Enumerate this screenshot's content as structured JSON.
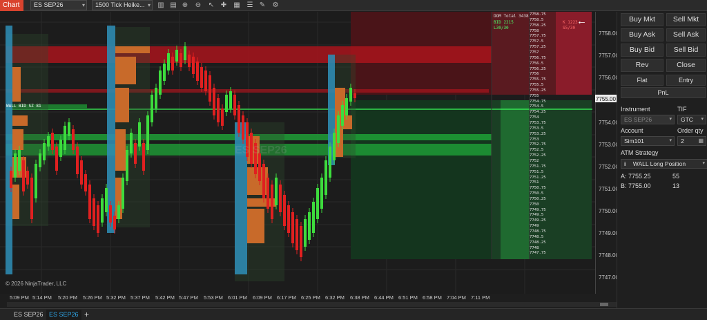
{
  "toolbar": {
    "app_tab": "Chart",
    "instrument": "ES SEP26",
    "bar_type": "1500 Tick Heike..."
  },
  "chart": {
    "watermark": "ES SEP26",
    "copyright": "© 2026 NinjaTrader, LLC",
    "wall_label": "WALL BID SZ 81",
    "last_price": "7755.00",
    "y_ticks": [
      "7758.00",
      "7757.00",
      "7756.00",
      "7755.00",
      "7754.00",
      "7753.00",
      "7752.00",
      "7751.00",
      "7750.00",
      "7749.00",
      "7748.00",
      "7747.00"
    ],
    "x_ticks": [
      "5:09 PM",
      "5:14 PM",
      "5:20 PM",
      "5:26 PM",
      "5:32 PM",
      "5:37 PM",
      "5:42 PM",
      "5:47 PM",
      "5:53 PM",
      "6:01 PM",
      "6:09 PM",
      "6:17 PM",
      "6:25 PM",
      "6:32 PM",
      "6:38 PM",
      "6:44 PM",
      "6:51 PM",
      "6:58 PM",
      "7:04 PM",
      "7:11 PM"
    ],
    "colors": {
      "up": "#3ddc3d",
      "down": "#e02020",
      "bid": "#1f7a33",
      "ask": "#8a1c22",
      "volume_blue": "#2e8fb8",
      "volume_orange": "#c86a2a"
    }
  },
  "dom": {
    "total": "DOM Total 3438",
    "bid": "BID 2215",
    "ask": "K 1223",
    "ratio_left": "L30/30",
    "ratio_right": "S5/30",
    "price_rows": [
      "7758.75",
      "7758.5",
      "7758.25",
      "7758",
      "7757.75",
      "7757.5",
      "7757.25",
      "7757",
      "7756.75",
      "7756.5",
      "7756.25",
      "7756",
      "7755.75",
      "7755.5",
      "7755.25",
      "7755",
      "7754.75",
      "7754.5",
      "7754.25",
      "7754",
      "7753.75",
      "7753.5",
      "7753.25",
      "7753",
      "7752.75",
      "7752.5",
      "7752.25",
      "7752",
      "7751.75",
      "7751.5",
      "7751.25",
      "7751",
      "7750.75",
      "7750.5",
      "7750.25",
      "7750",
      "7749.75",
      "7749.5",
      "7749.25",
      "7749",
      "7748.75",
      "7748.5",
      "7748.25",
      "7748",
      "7747.75"
    ]
  },
  "order_entry": {
    "buy_mkt": "Buy Mkt",
    "sell_mkt": "Sell Mkt",
    "buy_ask": "Buy Ask",
    "sell_ask": "Sell Ask",
    "buy_bid": "Buy Bid",
    "sell_bid": "Sell Bid",
    "rev": "Rev",
    "close": "Close",
    "flat": "Flat",
    "entry": "Entry",
    "pnl": "PnL",
    "instrument_label": "Instrument",
    "instrument_value": "ES SEP26",
    "tif_label": "TIF",
    "tif_value": "GTC",
    "account_label": "Account",
    "account_value": "Sim101",
    "qty_label": "Order qty",
    "qty_value": "2",
    "atm_label": "ATM Strategy",
    "atm_value": "WALL Long Position",
    "a_label": "A:",
    "a_price": "7755.25",
    "a_size": "55",
    "b_label": "B:",
    "b_price": "7755.00",
    "b_size": "13"
  },
  "bottom_tabs": [
    "ES SEP26",
    "ES SEP26",
    "+"
  ]
}
